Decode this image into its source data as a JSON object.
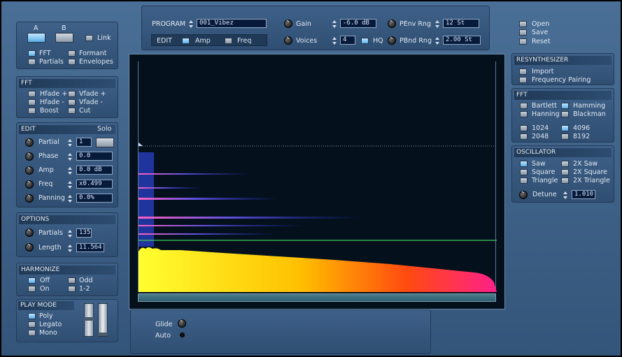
{
  "ab": {
    "a": "A",
    "b": "B",
    "link": "Link"
  },
  "view": {
    "fft": "FFT",
    "formant": "Formant",
    "partials": "Partials",
    "envelopes": "Envelopes"
  },
  "fft_panel": {
    "title": "FFT",
    "hfade_plus": "Hfade +",
    "vfade_plus": "Vfade +",
    "hfade_minus": "Hfade -",
    "vfade_minus": "Vfade -",
    "boost": "Boost",
    "cut": "Cut"
  },
  "edit": {
    "title": "EDIT",
    "solo": "Solo",
    "partial_label": "Partial",
    "partial_value": "1",
    "phase_label": "Phase",
    "phase_value": "0.0",
    "amp_label": "Amp",
    "amp_value": "0.0 dB",
    "freq_label": "Freq",
    "freq_value": "x0.499",
    "panning_label": "Panning",
    "panning_value": "0.0%"
  },
  "options": {
    "title": "OPTIONS",
    "partials_label": "Partials",
    "partials_value": "135",
    "length_label": "Length",
    "length_value": "11.564"
  },
  "harmonize": {
    "title": "HARMONIZE",
    "off": "Off",
    "odd": "Odd",
    "on": "On",
    "ratio": "1-2"
  },
  "playmode": {
    "title": "PLAY MODE",
    "poly": "Poly",
    "legato": "Legato",
    "mono": "Mono"
  },
  "top": {
    "program_label": "PROGRAM",
    "program_value": "001_Vibez",
    "edit_label": "EDIT",
    "amp": "Amp",
    "freq": "Freq",
    "gain_label": "Gain",
    "gain_value": "-6.0 dB",
    "voices_label": "Voices",
    "voices_value": "4",
    "hq": "HQ",
    "penv_label": "PEnv Rng",
    "penv_value": "12 St",
    "pbnd_label": "PBnd Rng",
    "pbnd_value": "2.00 St"
  },
  "file": {
    "open": "Open",
    "save": "Save",
    "reset": "Reset"
  },
  "resynth": {
    "title": "RESYNTHESIZER",
    "import": "Import",
    "pairing": "Frequency Pairing"
  },
  "fft_right": {
    "title": "FFT",
    "bartlett": "Bartlett",
    "hamming": "Hamming",
    "hanning": "Hanning",
    "blackman": "Blackman",
    "s1024": "1024",
    "s4096": "4096",
    "s2048": "2048",
    "s8192": "8192"
  },
  "osc": {
    "title": "OSCILLATOR",
    "saw": "Saw",
    "saw2": "2X Saw",
    "square": "Square",
    "square2": "2X Square",
    "triangle": "Triangle",
    "triangle2": "2X Triangle",
    "detune_label": "Detune",
    "detune_value": "1.010"
  },
  "bottom": {
    "glide": "Glide",
    "auto": "Auto"
  },
  "colors": {
    "accent": "#5ab0ec",
    "field_bg": "#071a3a",
    "display_bg": "#04101c",
    "partial_pink": "#e040c0",
    "partial_green": "#40d060"
  }
}
